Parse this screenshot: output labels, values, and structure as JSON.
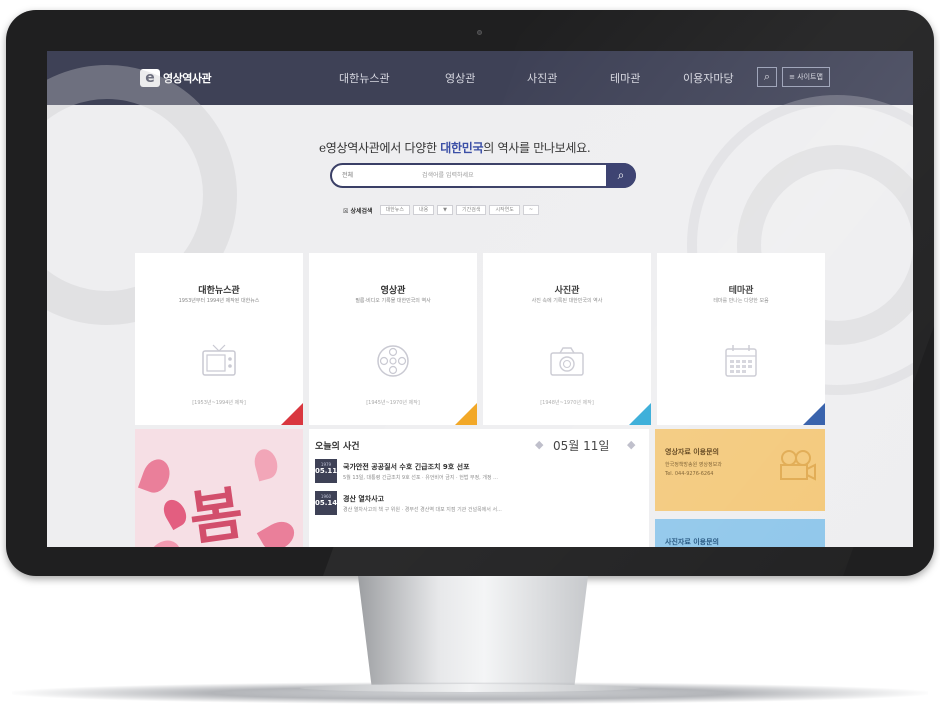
{
  "header": {
    "logo_mark": "e",
    "logo_text": "영상역사관",
    "nav": [
      "대한뉴스관",
      "영상관",
      "사진관",
      "테마관",
      "이용자마당"
    ],
    "sitemap_label": "사이트맵"
  },
  "hero": {
    "tagline_prefix": "e영상역사관에서 다양한 ",
    "tagline_highlight": "대한민국",
    "tagline_suffix": "의 역사를 만나보세요.",
    "search_scope": "전체",
    "search_placeholder": "검색어를 입력하세요",
    "filter_label": "상세검색",
    "filter_chips": [
      "대한뉴스",
      "내용",
      "▼",
      "기간검색",
      "시작연도",
      "~"
    ]
  },
  "cards": [
    {
      "title": "대한뉴스관",
      "subtitle": "1953년부터 1994년 제작된 대한뉴스",
      "note": "[1953년~1994년 제작]",
      "corner_color": "#d9373f"
    },
    {
      "title": "영상관",
      "subtitle": "필름·비디오 기록물 대한민국의 역사",
      "note": "[1945년~1970년 제작]",
      "corner_color": "#f1a21a"
    },
    {
      "title": "사진관",
      "subtitle": "사진 속에 기록된 대한민국의 역사",
      "note": "[1948년~1970년 제작]",
      "corner_color": "#2aa7d6"
    },
    {
      "title": "테마관",
      "subtitle": "테마를 만나는 다양한 모음",
      "note": "",
      "corner_color": "#2e5aa8"
    }
  ],
  "banner": {
    "text": "봄"
  },
  "today": {
    "title": "오늘의 사건",
    "date": "05월 11일",
    "events": [
      {
        "year": "1979",
        "md": "05.11",
        "title": "국가안전 공공질서 수호 긴급조치 9호 선포",
        "desc": "5월 13일, 대통령 긴급조치 9호 선포 · 유언비어 금지 · 헌법 부정, 개정 ..."
      },
      {
        "year": "1960",
        "md": "05.14",
        "title": "경산 열차사고",
        "desc": "경산 열차사고의 책 구 위원 · 경부선 경산역 대포 지점 기관 건널목에서 서..."
      }
    ]
  },
  "inquiries": [
    {
      "title": "영상자료 이용문의",
      "lines": [
        "한국정책방송원 영상정보과",
        "Tel. 044-9276-6264"
      ]
    },
    {
      "title": "사진자료 이용문의",
      "lines": []
    }
  ]
}
